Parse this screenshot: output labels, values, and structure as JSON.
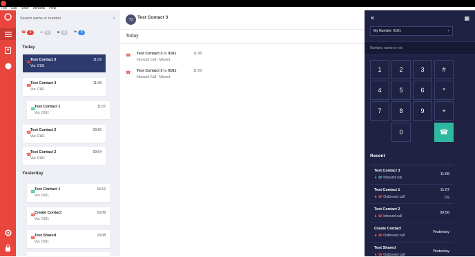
{
  "menu": [
    "File",
    "Edit",
    "View",
    "Window",
    "Help"
  ],
  "search": {
    "placeholder": "Search name or number"
  },
  "filters": [
    {
      "icon": "missed-icon",
      "count": "1",
      "color": "#e8453c"
    },
    {
      "icon": "voicemail-icon",
      "count": "0",
      "color": "#c9ccd6"
    },
    {
      "icon": "chat-icon",
      "count": "0",
      "color": "#c9ccd6"
    },
    {
      "icon": "flag-icon",
      "count": "4",
      "color": "#3a8cf0"
    }
  ],
  "list": {
    "today_label": "Today",
    "yesterday_label": "Yesterday",
    "today": [
      {
        "name": "Test Contact 3",
        "via": "Via: 0161",
        "time": "11:09",
        "icon": "missed",
        "selected": true
      },
      {
        "name": "Test Contact 3",
        "via": "Via: 0161",
        "time": "11:08",
        "icon": "missed"
      },
      {
        "name": "Test Contact 1",
        "via": "Via: 0161",
        "time": "11:07",
        "icon": "outbound"
      },
      {
        "name": "Test Contact 2",
        "via": "Via: 0161",
        "time": "09:56",
        "icon": "missed"
      },
      {
        "name": "Test Contact 2",
        "via": "Via: 0161",
        "time": "09:54",
        "icon": "missed"
      }
    ],
    "yesterday": [
      {
        "name": "Test Contact 1",
        "via": "Via: 0161",
        "time": "15:12",
        "icon": "outbound"
      },
      {
        "name": "Create Contact",
        "via": "Via: 0161",
        "time": "15:09",
        "icon": "missed"
      },
      {
        "name": "Test Shared",
        "via": "Via: 0161",
        "time": "15:08",
        "icon": "missed"
      }
    ]
  },
  "main": {
    "avatar": "T3",
    "title": "Test Contact 3",
    "section": "Today",
    "events": [
      {
        "from": "Test Contact 3",
        "to": "to",
        "num": "0161",
        "type": "Inbound Call - Missed",
        "time": "11:08"
      },
      {
        "from": "Test Contact 3",
        "to": "to",
        "num": "0161",
        "type": "Inbound Call - Missed",
        "time": "11:09"
      }
    ]
  },
  "dialer": {
    "my_number": "My Number: 0161",
    "input_placeholder": "Number, name or ext",
    "keys": [
      "1",
      "2",
      "3",
      "#",
      "4",
      "5",
      "6",
      "*",
      "7",
      "8",
      "9",
      "+",
      "0"
    ],
    "recent_label": "Recent",
    "recent": [
      {
        "name": "Test Contact 3",
        "type": "Inbound call",
        "time": "11:09",
        "dur": ""
      },
      {
        "name": "Test Contact 1",
        "type": "Outbound call",
        "time": "11:07",
        "dur": "10s"
      },
      {
        "name": "Test Contact 2",
        "type": "Inbound call",
        "time": "09:56",
        "dur": ""
      },
      {
        "name": "Create Contact",
        "type": "Outbound call",
        "time": "Yesterday",
        "dur": ""
      },
      {
        "name": "Test Shared",
        "type": "Outbound call",
        "time": "Yesterday",
        "dur": ""
      }
    ]
  }
}
